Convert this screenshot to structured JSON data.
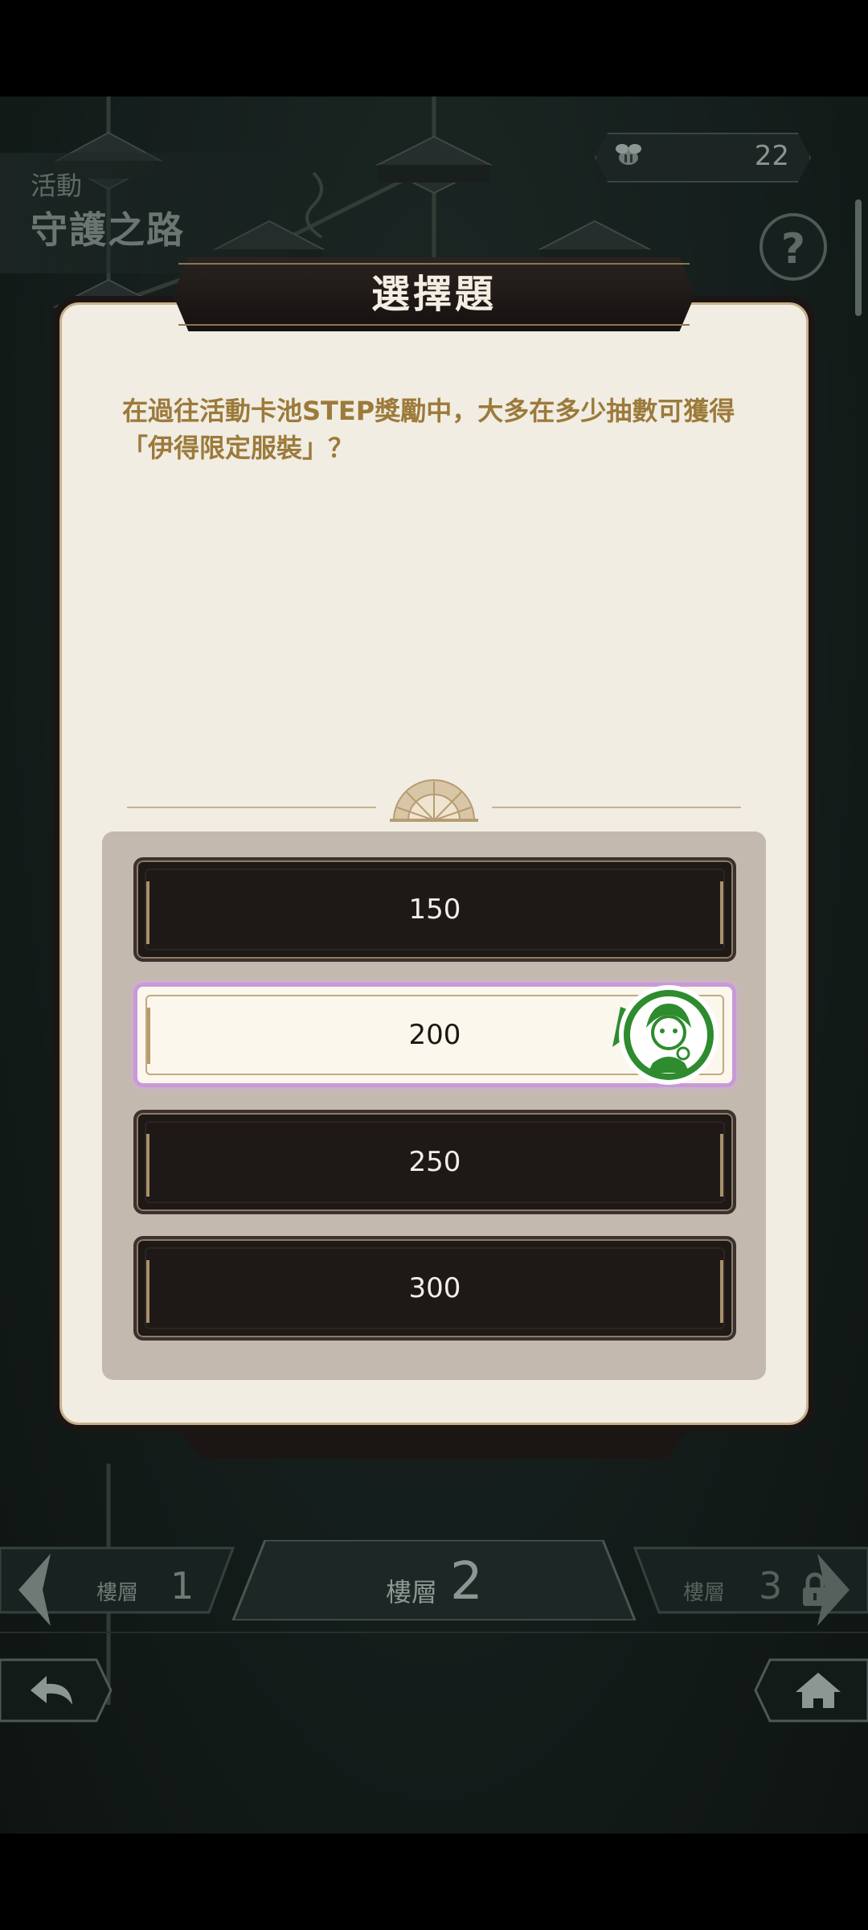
{
  "event": {
    "label": "活動",
    "name": "守護之路"
  },
  "currency": {
    "value": "22",
    "icon": "bee-icon"
  },
  "help": {
    "label": "?"
  },
  "dialog": {
    "title": "選擇題",
    "question_lines": [
      "在過往活動卡池STEP獎勵中，大多在多少抽數可獲得",
      "「伊得限定服裝」？"
    ],
    "options": [
      "150",
      "200",
      "250",
      "300"
    ],
    "selected_index": 1
  },
  "floors": {
    "left": {
      "label": "樓層",
      "number": "1"
    },
    "current": {
      "label": "樓層",
      "number": "2"
    },
    "right": {
      "label": "樓層",
      "number": "3",
      "locked": true
    }
  },
  "colors": {
    "accent_gold": "#9c7a3a",
    "selected_border": "#c89ad8",
    "badge_green": "#2e8b2e"
  }
}
